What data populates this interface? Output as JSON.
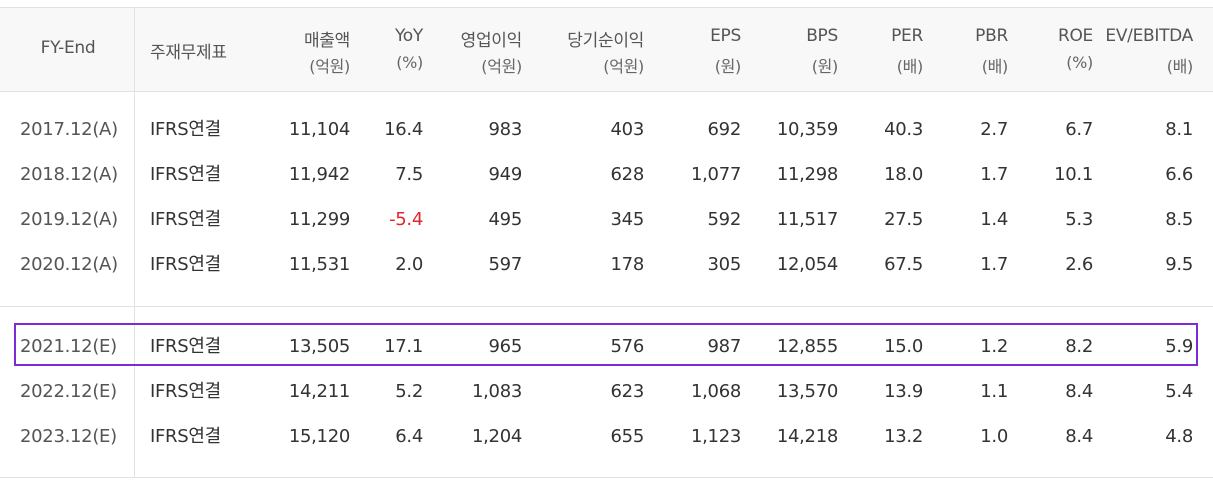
{
  "columns": [
    {
      "label": "FY-End",
      "unit": ""
    },
    {
      "label": "주재무제표",
      "unit": ""
    },
    {
      "label": "매출액",
      "unit": "(억원)"
    },
    {
      "label": "YoY",
      "unit": "(%)"
    },
    {
      "label": "영업이익",
      "unit": "(억원)"
    },
    {
      "label": "당기순이익",
      "unit": "(억원)"
    },
    {
      "label": "EPS",
      "unit": "(원)"
    },
    {
      "label": "BPS",
      "unit": "(원)"
    },
    {
      "label": "PER",
      "unit": "(배)"
    },
    {
      "label": "PBR",
      "unit": "(배)"
    },
    {
      "label": "ROE",
      "unit": "(%)"
    },
    {
      "label": "EV/EBITDA",
      "unit": "(배)"
    }
  ],
  "rows": [
    [
      "2017.12(A)",
      "IFRS연결",
      "11,104",
      "16.4",
      "983",
      "403",
      "692",
      "10,359",
      "40.3",
      "2.7",
      "6.7",
      "8.1"
    ],
    [
      "2018.12(A)",
      "IFRS연결",
      "11,942",
      "7.5",
      "949",
      "628",
      "1,077",
      "11,298",
      "18.0",
      "1.7",
      "10.1",
      "6.6"
    ],
    [
      "2019.12(A)",
      "IFRS연결",
      "11,299",
      "-5.4",
      "495",
      "345",
      "592",
      "11,517",
      "27.5",
      "1.4",
      "5.3",
      "8.5"
    ],
    [
      "2020.12(A)",
      "IFRS연결",
      "11,531",
      "2.0",
      "597",
      "178",
      "305",
      "12,054",
      "67.5",
      "1.7",
      "2.6",
      "9.5"
    ],
    [
      "2021.12(E)",
      "IFRS연결",
      "13,505",
      "17.1",
      "965",
      "576",
      "987",
      "12,855",
      "15.0",
      "1.2",
      "8.2",
      "5.9"
    ],
    [
      "2022.12(E)",
      "IFRS연결",
      "14,211",
      "5.2",
      "1,083",
      "623",
      "1,068",
      "13,570",
      "13.9",
      "1.1",
      "8.4",
      "5.4"
    ],
    [
      "2023.12(E)",
      "IFRS연결",
      "15,120",
      "6.4",
      "1,204",
      "655",
      "1,123",
      "14,218",
      "13.2",
      "1.0",
      "8.4",
      "4.8"
    ]
  ],
  "colors": {
    "highlight_border": "#7d2bd9",
    "negative": "#e0272c",
    "header_bg": "#f8f8f8",
    "grid": "#e2e2e2"
  },
  "highlighted_row_index": 4
}
